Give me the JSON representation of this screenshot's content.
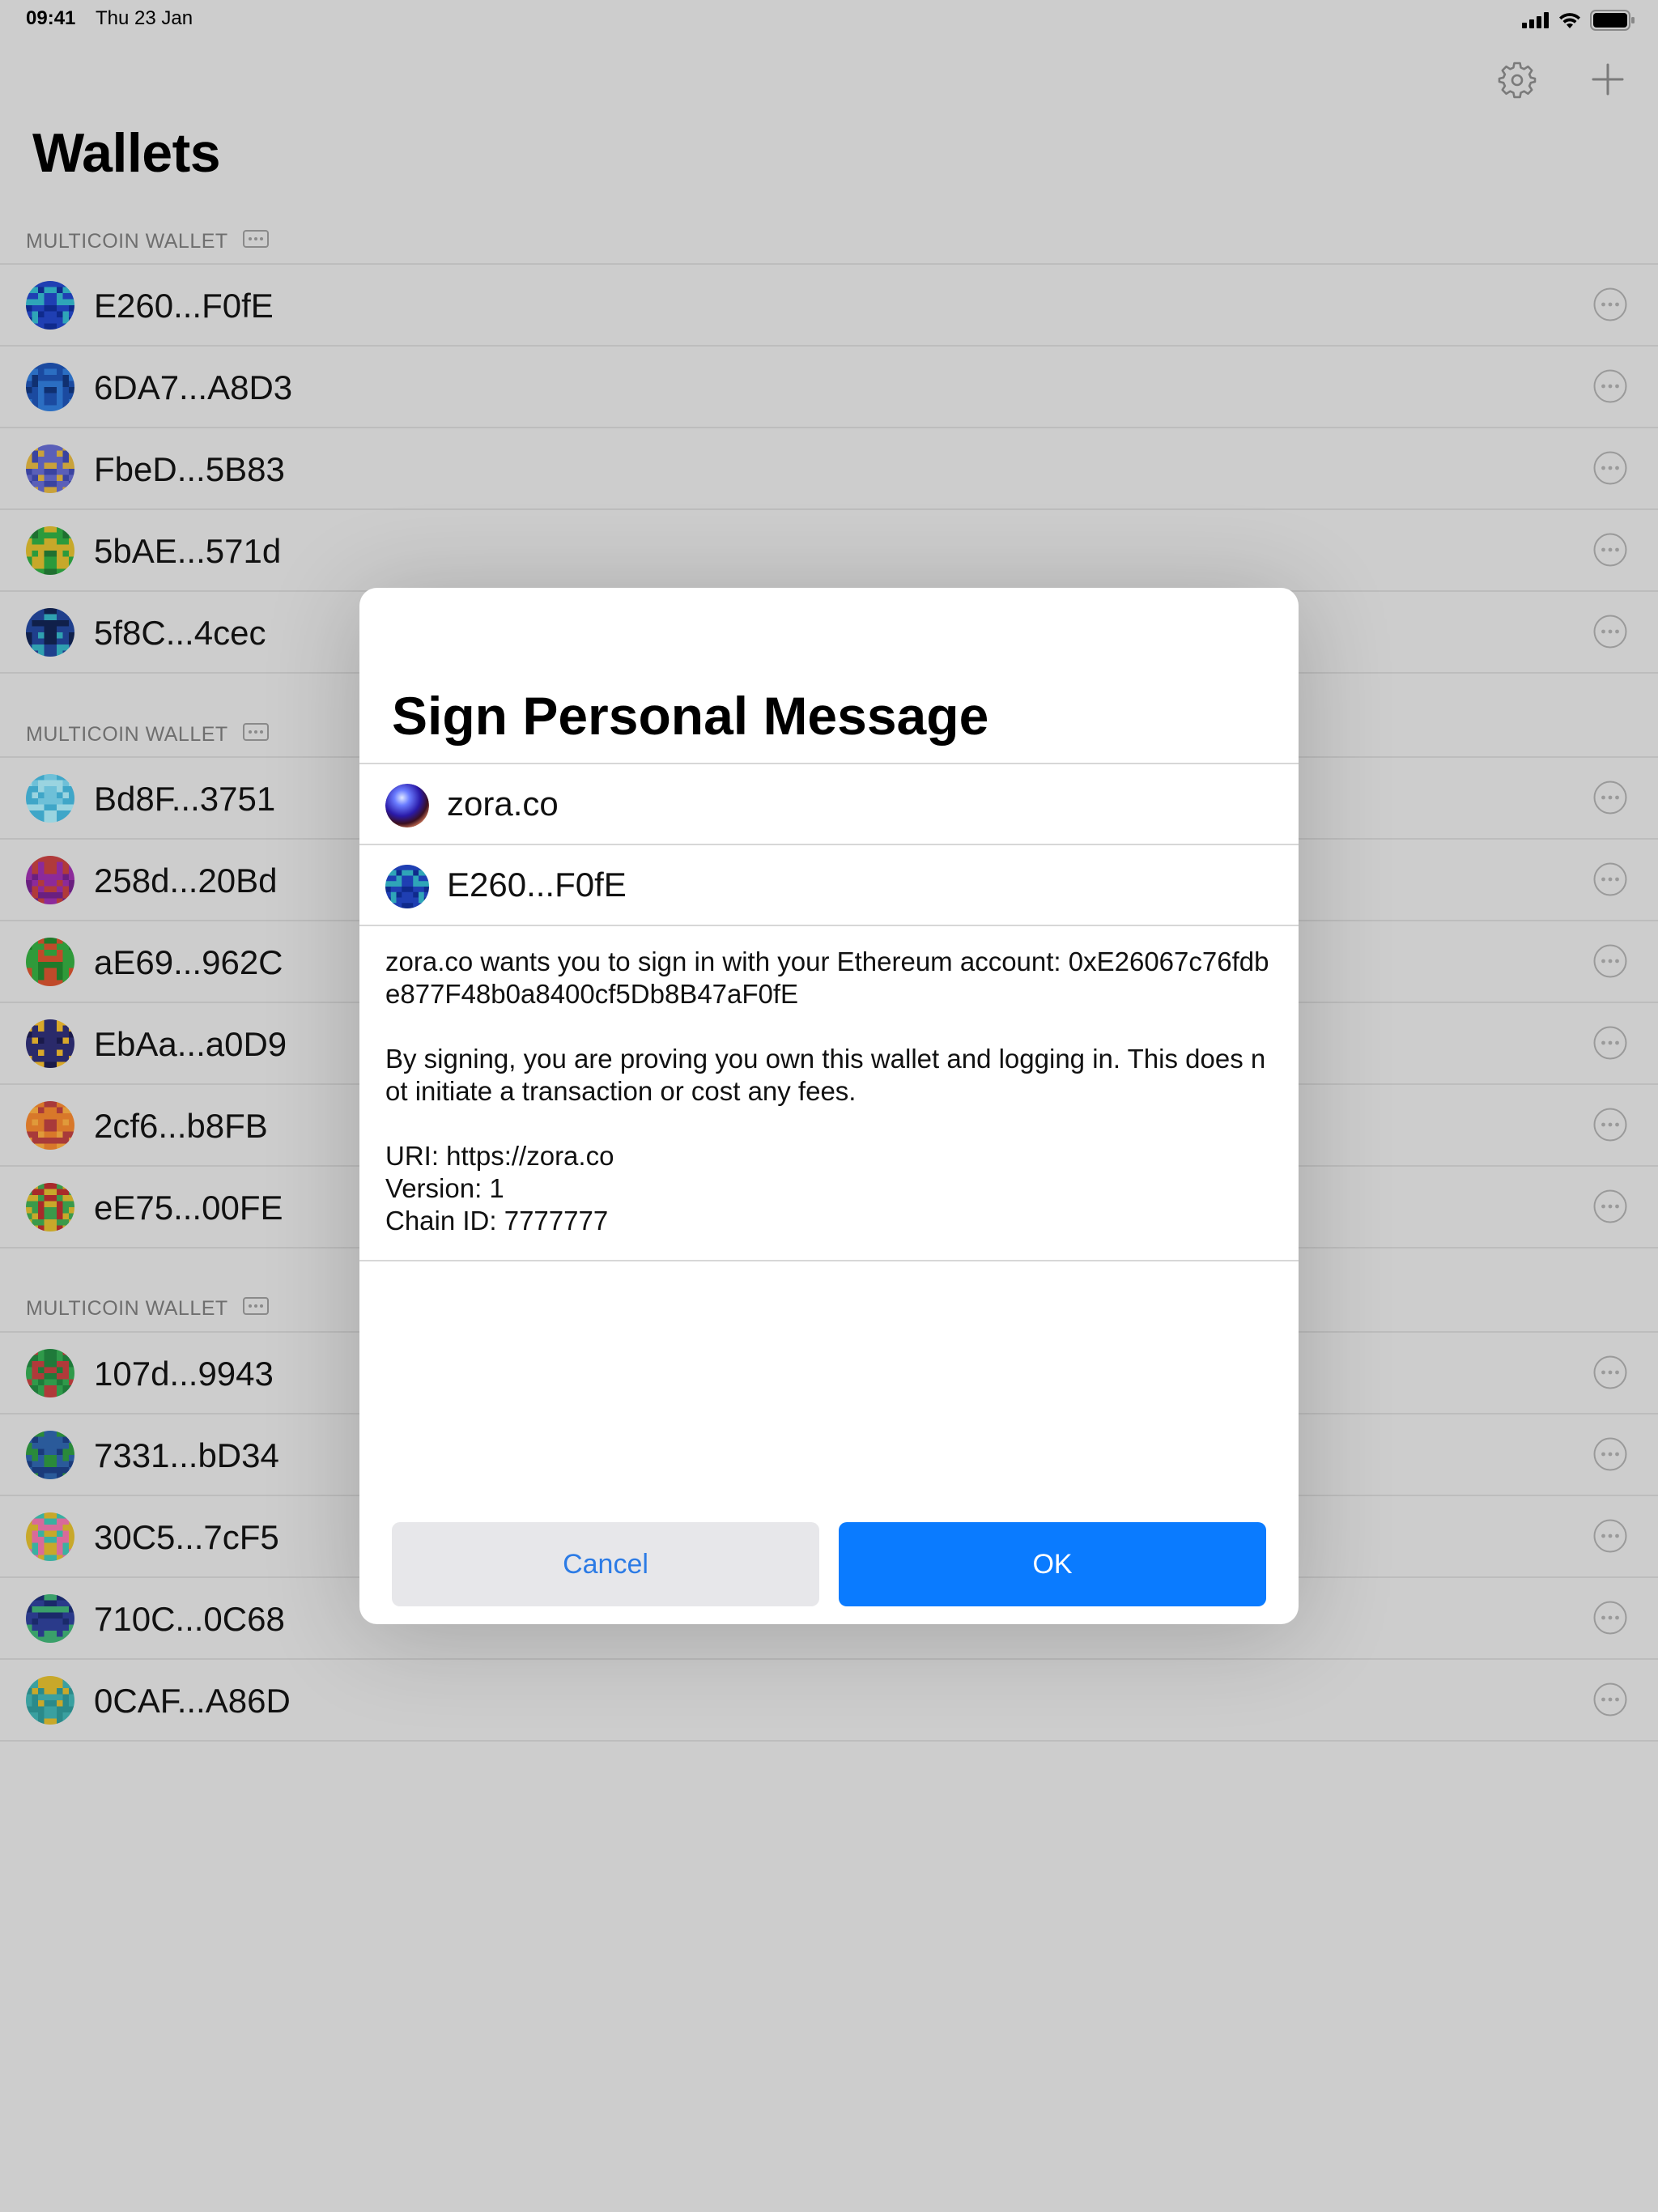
{
  "status_bar": {
    "time": "09:41",
    "date": "Thu 23 Jan"
  },
  "nav": {
    "title": "Wallets",
    "settings_icon": "gear-icon",
    "add_icon": "plus-icon"
  },
  "sections": [
    {
      "header": "MULTICOIN WALLET",
      "wallets": [
        {
          "address": "E260...F0fE",
          "colors": [
            "#1f3fb3",
            "#2fa5b8",
            "#0f2a8c"
          ]
        },
        {
          "address": "6DA7...A8D3",
          "colors": [
            "#1b4aa0",
            "#2b6ec2",
            "#103070"
          ]
        },
        {
          "address": "FbeD...5B83",
          "colors": [
            "#5a5fb8",
            "#c9a23a",
            "#3a43a0"
          ]
        },
        {
          "address": "5bAE...571d",
          "colors": [
            "#2b9a3c",
            "#c7a82a",
            "#1f7030"
          ]
        },
        {
          "address": "5f8C...4cec",
          "colors": [
            "#1f3f8c",
            "#2fa0b0",
            "#10204a"
          ]
        }
      ]
    },
    {
      "header": "MULTICOIN WALLET",
      "wallets": [
        {
          "address": "Bd8F...3751",
          "colors": [
            "#6ec0d8",
            "#3fa6c8",
            "#9ad4e0"
          ]
        },
        {
          "address": "258d...20Bd",
          "colors": [
            "#8c2a9a",
            "#b03a3a",
            "#6a1f80"
          ]
        },
        {
          "address": "aE69...962C",
          "colors": [
            "#2f9a3a",
            "#c04a2a",
            "#1f7a2a"
          ]
        },
        {
          "address": "EbAa...a0D9",
          "colors": [
            "#2a2a6a",
            "#d8a82a",
            "#1a1a4a"
          ]
        },
        {
          "address": "2cf6...b8FB",
          "colors": [
            "#d8782a",
            "#a83a3a",
            "#e09a3a"
          ]
        },
        {
          "address": "eE75...00FE",
          "colors": [
            "#c8a82a",
            "#a82a2a",
            "#3a9a4a"
          ]
        }
      ]
    },
    {
      "header": "MULTICOIN WALLET",
      "wallets": [
        {
          "address": "107d...9943",
          "colors": [
            "#2f9a4a",
            "#b03a3a",
            "#1f7a3a"
          ]
        },
        {
          "address": "7331...bD34",
          "colors": [
            "#2a5a9a",
            "#2a8a3a",
            "#1a3a7a"
          ]
        },
        {
          "address": "30C5...7cF5",
          "colors": [
            "#d86a9a",
            "#3ab0a0",
            "#c8a82a"
          ]
        },
        {
          "address": "710C...0C68",
          "colors": [
            "#2a3a8a",
            "#3aa06a",
            "#1a2a6a"
          ]
        },
        {
          "address": "0CAF...A86D",
          "colors": [
            "#3aa0a0",
            "#c8a82a",
            "#2a8a8a"
          ]
        }
      ]
    }
  ],
  "modal": {
    "title": "Sign Personal Message",
    "dapp": "zora.co",
    "account": "E260...F0fE",
    "message": "zora.co wants you to sign in with your Ethereum account: 0xE26067c76fdbe877F48b0a8400cf5Db8B47aF0fE\n\nBy signing, you are proving you own this wallet and logging in. This does not initiate a transaction or cost any fees.\n\nURI: https://zora.co\nVersion: 1\nChain ID: 7777777",
    "cancel_label": "Cancel",
    "ok_label": "OK"
  }
}
